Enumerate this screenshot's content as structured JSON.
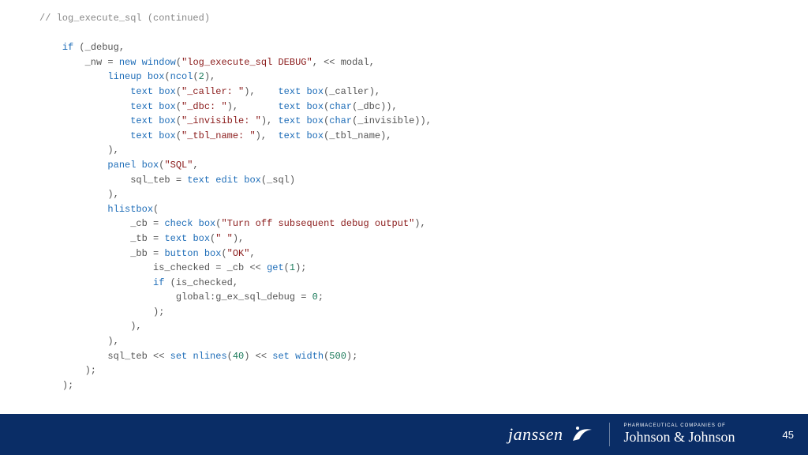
{
  "code": {
    "comment": "// log_execute_sql (continued)",
    "kw_if1": "if",
    "if_open": " (_debug,",
    "nw_assign": "_nw = ",
    "kw_new": "new",
    "sp1": " ",
    "fn_window": "window",
    "win_open": "(",
    "str_debug_title": "\"log_execute_sql DEBUG\"",
    "win_after": ", << modal,",
    "fn_lineup": "lineup box",
    "lb_open": "(",
    "fn_ncol": "ncol",
    "ncol_open": "(",
    "num_2": "2",
    "ncol_close": "),",
    "fn_tb1": "text box",
    "tb1_open": "(",
    "str_caller": "\"_caller: \"",
    "tb1_close": "),    ",
    "fn_tb1b": "text box",
    "tb1b": "(_caller),",
    "fn_tb2": "text box",
    "tb2_open": "(",
    "str_dbc": "\"_dbc: \"",
    "tb2_close": "),       ",
    "fn_tb2b": "text box",
    "tb2b_open": "(",
    "fn_char1": "char",
    "tb2b": "(_dbc)),",
    "fn_tb3": "text box",
    "tb3_open": "(",
    "str_inv": "\"_invisible: \"",
    "tb3_close": "), ",
    "fn_tb3b": "text box",
    "tb3b_open": "(",
    "fn_char2": "char",
    "tb3b": "(_invisible)),",
    "fn_tb4": "text box",
    "tb4_open": "(",
    "str_tbl": "\"_tbl_name: \"",
    "tb4_close": "),  ",
    "fn_tb4b": "text box",
    "tb4b": "(_tbl_name),",
    "lb_close": "),",
    "fn_panel": "panel box",
    "pb_open": "(",
    "str_sql": "\"SQL\"",
    "pb_after": ",",
    "sqlteb_assign": "sql_teb = ",
    "fn_teb": "text edit box",
    "teb_arg": "(_sql)",
    "pb_close": "),",
    "fn_hlist": "hlistbox",
    "hl_open": "(",
    "cb_assign": "_cb = ",
    "fn_cb": "check box",
    "cb_open": "(",
    "str_turnoff": "\"Turn off subsequent debug output\"",
    "cb_close": "),",
    "tbx_assign": "_tb = ",
    "fn_tbx": "text box",
    "tbx_open": "(",
    "str_space": "\" \"",
    "tbx_close": "),",
    "bb_assign": "_bb = ",
    "fn_bb": "button box",
    "bb_open": "(",
    "str_ok": "\"OK\"",
    "bb_after": ",",
    "isc_line": "is_checked = _cb << ",
    "fn_get": "get",
    "get_open": "(",
    "num_1": "1",
    "get_close": ");",
    "kw_if2": "if",
    "if2_open": " (is_checked,",
    "glob_line": "global:g_ex_sql_debug = ",
    "num_0": "0",
    "glob_end": ";",
    "if2_close": ");",
    "bb_close": "),",
    "hl_close": "),",
    "sqlteb_line": "sql_teb << ",
    "fn_nlines": "set nlines",
    "nl_open": "(",
    "num_40": "40",
    "nl_close": ") << ",
    "fn_width": "set width",
    "w_open": "(",
    "num_500": "500",
    "w_close": ");",
    "win_close": ");",
    "if_close": ");"
  },
  "footer": {
    "janssen": "janssen",
    "jnj_tag": "PHARMACEUTICAL COMPANIES OF",
    "jnj": "Johnson & Johnson",
    "page": "45"
  }
}
